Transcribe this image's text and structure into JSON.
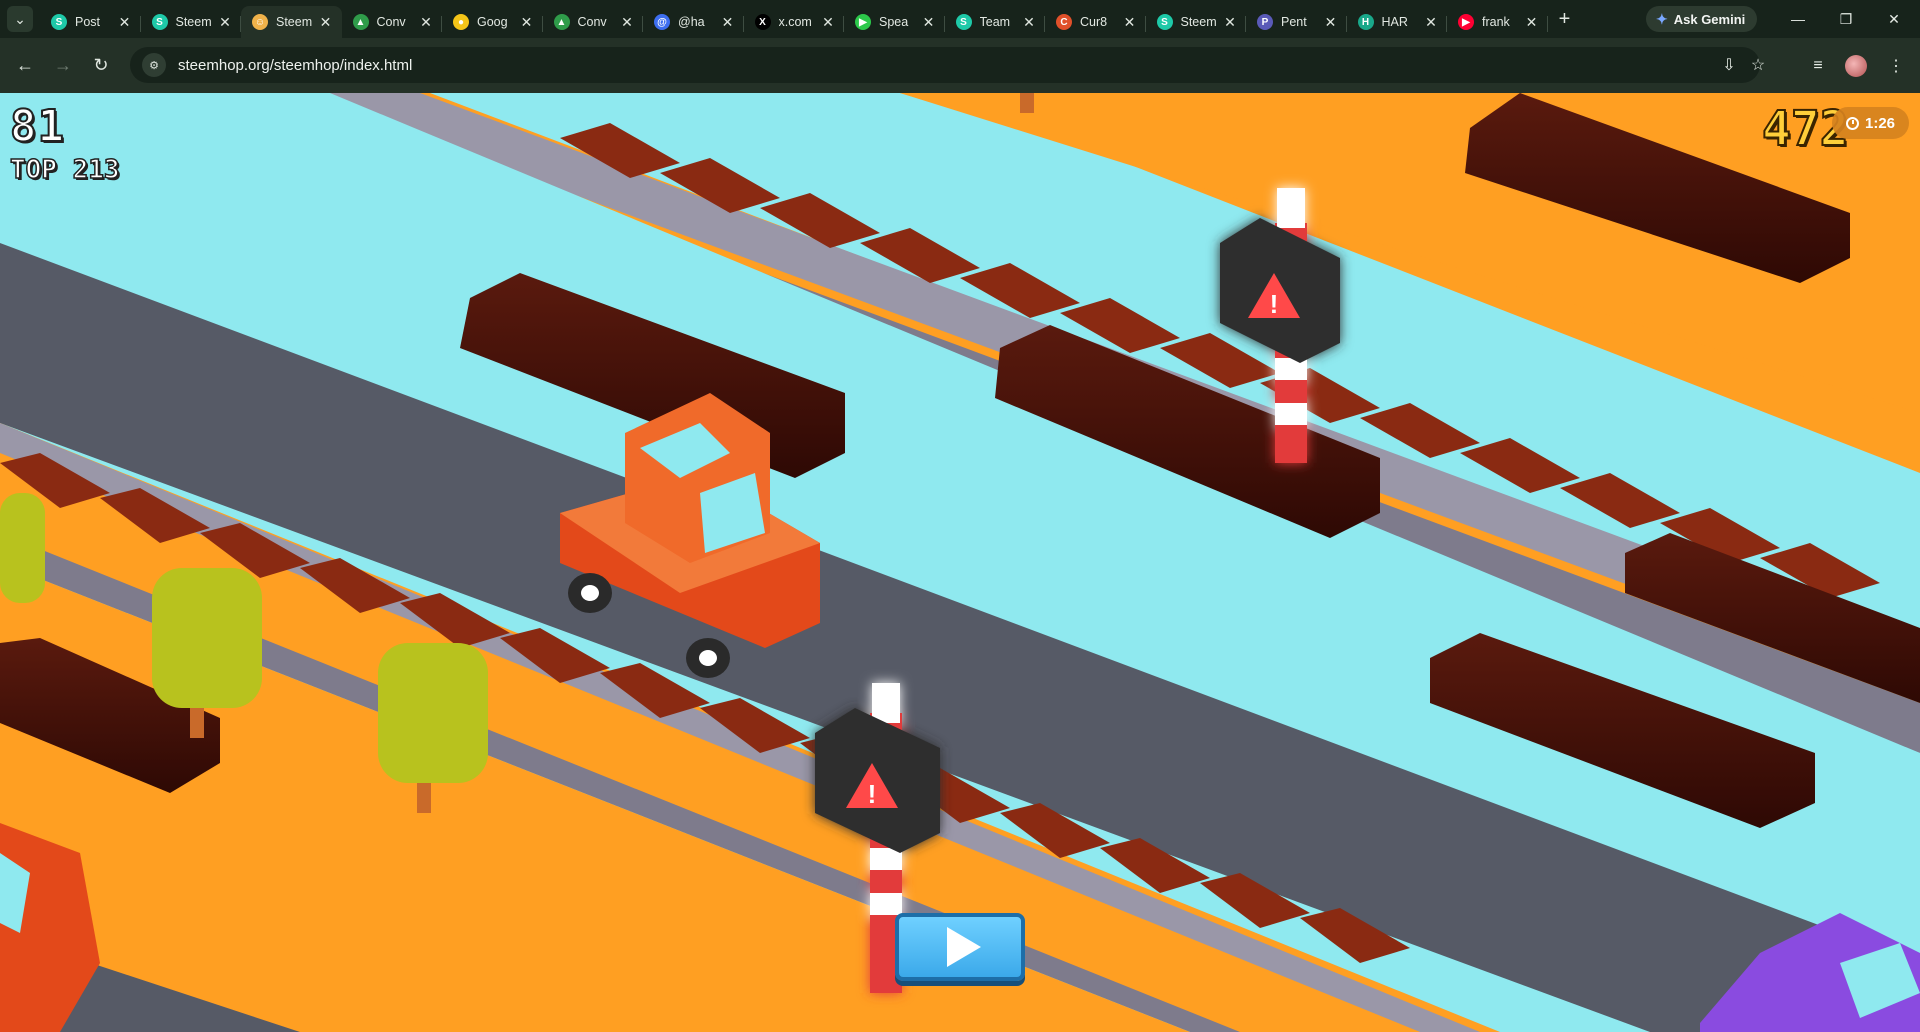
{
  "browser": {
    "tabs": [
      {
        "title": "Post",
        "fav_color": "#1ec9a8",
        "fav_glyph": "S",
        "active": false
      },
      {
        "title": "Steem",
        "fav_color": "#1ec9a8",
        "fav_glyph": "S",
        "active": false
      },
      {
        "title": "Steem",
        "fav_color": "#f0b24a",
        "fav_glyph": "☺",
        "active": true
      },
      {
        "title": "Conv",
        "fav_color": "#2f9c4a",
        "fav_glyph": "▲",
        "active": false
      },
      {
        "title": "Goog",
        "fav_color": "#f5c518",
        "fav_glyph": "●",
        "active": false
      },
      {
        "title": "Conv",
        "fav_color": "#2f9c4a",
        "fav_glyph": "▲",
        "active": false
      },
      {
        "title": "@ha",
        "fav_color": "#3d6ef0",
        "fav_glyph": "@",
        "active": false
      },
      {
        "title": "x.com",
        "fav_color": "#000000",
        "fav_glyph": "X",
        "active": false
      },
      {
        "title": "Spea",
        "fav_color": "#2cc84a",
        "fav_glyph": "▶",
        "active": false
      },
      {
        "title": "Team",
        "fav_color": "#1ec9a8",
        "fav_glyph": "S",
        "active": false
      },
      {
        "title": "Cur8",
        "fav_color": "#e0502a",
        "fav_glyph": "C",
        "active": false
      },
      {
        "title": "Steem",
        "fav_color": "#1ec9a8",
        "fav_glyph": "S",
        "active": false
      },
      {
        "title": "Pent",
        "fav_color": "#5a5ab8",
        "fav_glyph": "P",
        "active": false
      },
      {
        "title": "HAR",
        "fav_color": "#19a88a",
        "fav_glyph": "H",
        "active": false
      },
      {
        "title": "frank",
        "fav_color": "#ff0033",
        "fav_glyph": "▶",
        "active": false
      }
    ],
    "ask_gemini_label": "Ask Gemini",
    "url": "steemhop.org/steemhop/index.html"
  },
  "hud": {
    "score": "81",
    "top_label": "TOP 213",
    "coins": "472",
    "timer": "1:26"
  },
  "game": {
    "play_button_icon": "play-icon",
    "colors": {
      "water": "#8fe9ef",
      "grass": "#ff9f22",
      "road": "#565a66",
      "rail_tie": "#8a2a12",
      "log": "#3a0c06",
      "car_orange": "#f05a22",
      "car_purple": "#8a4be0",
      "tree": "#b8c21e",
      "button": "#4db8f0"
    }
  }
}
